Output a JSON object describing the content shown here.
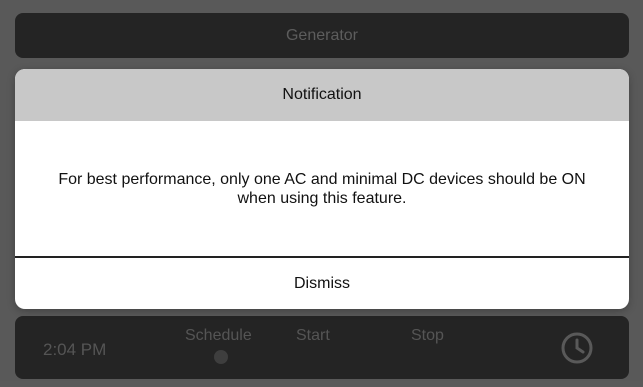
{
  "header": {
    "title": "Generator"
  },
  "footer": {
    "time": "2:04 PM",
    "schedule_label": "Schedule",
    "start_label": "Start",
    "stop_label": "Stop",
    "clock_icon": "clock-icon"
  },
  "dialog": {
    "title": "Notification",
    "message": "For best performance, only one AC and minimal DC devices should be ON when using this feature.",
    "dismiss_label": "Dismiss"
  },
  "colors": {
    "background": "#5a5a5a",
    "bar": "#1c1c1c",
    "dialog_header": "#c8c8c8",
    "dialog_body": "#ffffff"
  }
}
